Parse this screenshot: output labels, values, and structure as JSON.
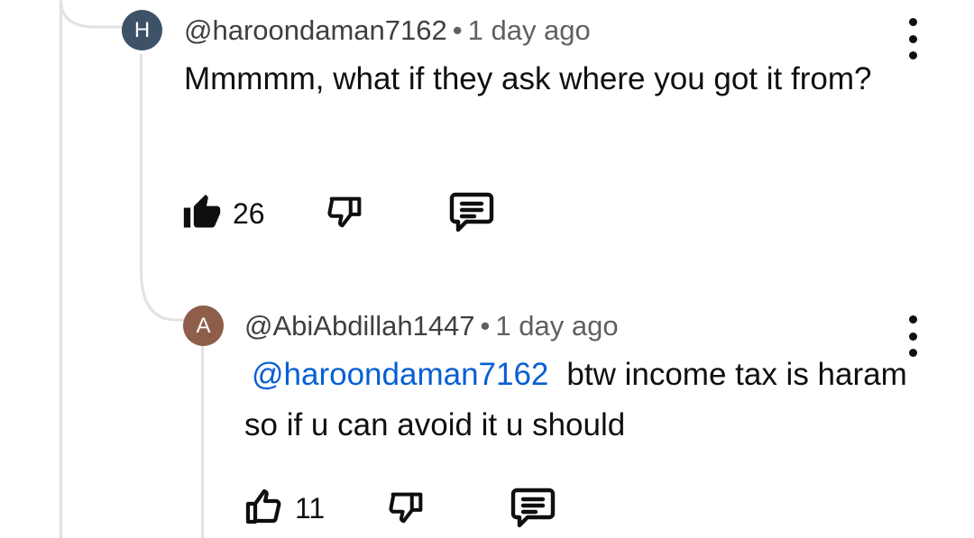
{
  "comments": [
    {
      "avatar_letter": "H",
      "avatar_color": "#3d5266",
      "handle": "@haroondaman7162",
      "separator": "•",
      "time": "1 day ago",
      "text": "Mmmmm, what if they ask where you got it from?",
      "likes": "26",
      "liked": true
    },
    {
      "avatar_letter": "A",
      "avatar_color": "#8f5e4b",
      "handle": "@AbiAbdillah1447",
      "separator": "•",
      "time": "1 day ago",
      "mention": "@haroondaman7162",
      "text": "btw income tax is haram so if u can avoid it u should",
      "likes": "11",
      "liked": false
    }
  ],
  "icons": {
    "like": "thumbs-up-icon",
    "dislike": "thumbs-down-icon",
    "reply": "reply-comment-icon",
    "more": "more-vertical-icon"
  }
}
